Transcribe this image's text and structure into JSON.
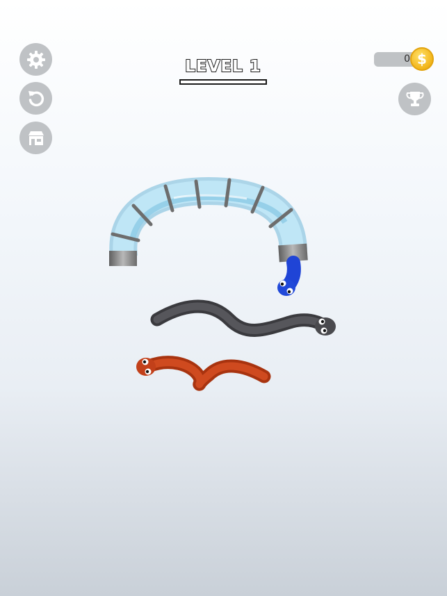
{
  "hud": {
    "level_title": "LEVEL 1",
    "coins": "0",
    "coin_symbol": "$"
  },
  "buttons": {
    "settings_icon": "gear-icon",
    "restart_icon": "restart-icon",
    "shop_icon": "shop-icon",
    "trophy_icon": "trophy-icon"
  },
  "colors": {
    "button_gray": "#bfc2c5",
    "tube_glass": "#a9daf0",
    "tube_band": "#7a7a7a",
    "snake_blue": "#1f44d6",
    "snake_gray": "#4a4a4e",
    "snake_orange": "#c2401a",
    "coin_gold": "#f2b51a"
  },
  "scene": {
    "objects": [
      "glass-tube",
      "blue-snake",
      "gray-snake",
      "orange-snake"
    ]
  }
}
